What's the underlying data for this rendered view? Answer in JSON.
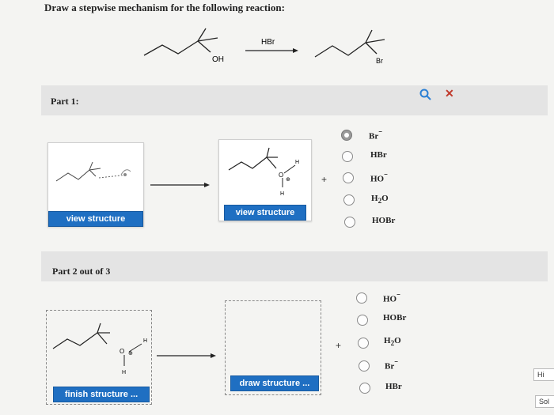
{
  "prompt": "Draw a stepwise mechanism for the following reaction:",
  "reaction": {
    "reagent": "HBr",
    "left_group": "OH",
    "right_group": "Br"
  },
  "part1": {
    "title": "Part 1:",
    "view_button_1": "view structure",
    "view_button_2": "view structure",
    "atom_labels": {
      "h_top": "H",
      "o": "O",
      "charge": "⊕",
      "h_bottom": "H"
    },
    "plus": "+",
    "options": [
      {
        "label": "Br",
        "sup": "⁻",
        "sub": "",
        "selected": true
      },
      {
        "label": "HBr",
        "sup": "",
        "sub": "",
        "selected": false
      },
      {
        "label": "HO",
        "sup": "⁻",
        "sub": "",
        "selected": false
      },
      {
        "label": "H",
        "sup": "",
        "sub": "2",
        "suffix": "O",
        "selected": false
      },
      {
        "label": "HOBr",
        "sup": "",
        "sub": "",
        "selected": false
      }
    ]
  },
  "part2": {
    "title": "Part 2 out of 3",
    "finish_button": "finish structure ...",
    "draw_button": "draw structure ...",
    "atom_labels": {
      "h_top": "H",
      "o": "O",
      "charge": "⊕",
      "h_bottom": "H"
    },
    "plus": "+",
    "options": [
      {
        "label": "HO",
        "sup": "⁻",
        "sub": "",
        "selected": false
      },
      {
        "label": "HOBr",
        "sup": "",
        "sub": "",
        "selected": false
      },
      {
        "label": "H",
        "sup": "",
        "sub": "2",
        "suffix": "O",
        "selected": false
      },
      {
        "label": "Br",
        "sup": "⁻",
        "sub": "",
        "selected": false
      },
      {
        "label": "HBr",
        "sup": "",
        "sub": "",
        "selected": false
      }
    ]
  },
  "side": {
    "hint_label": "Hi",
    "solution_label": "Sol"
  },
  "colors": {
    "accent": "#1f6fc2",
    "close": "#c0392b",
    "search": "#2a7fd4"
  },
  "icons": {
    "search": "search-icon",
    "close": "close-icon"
  }
}
